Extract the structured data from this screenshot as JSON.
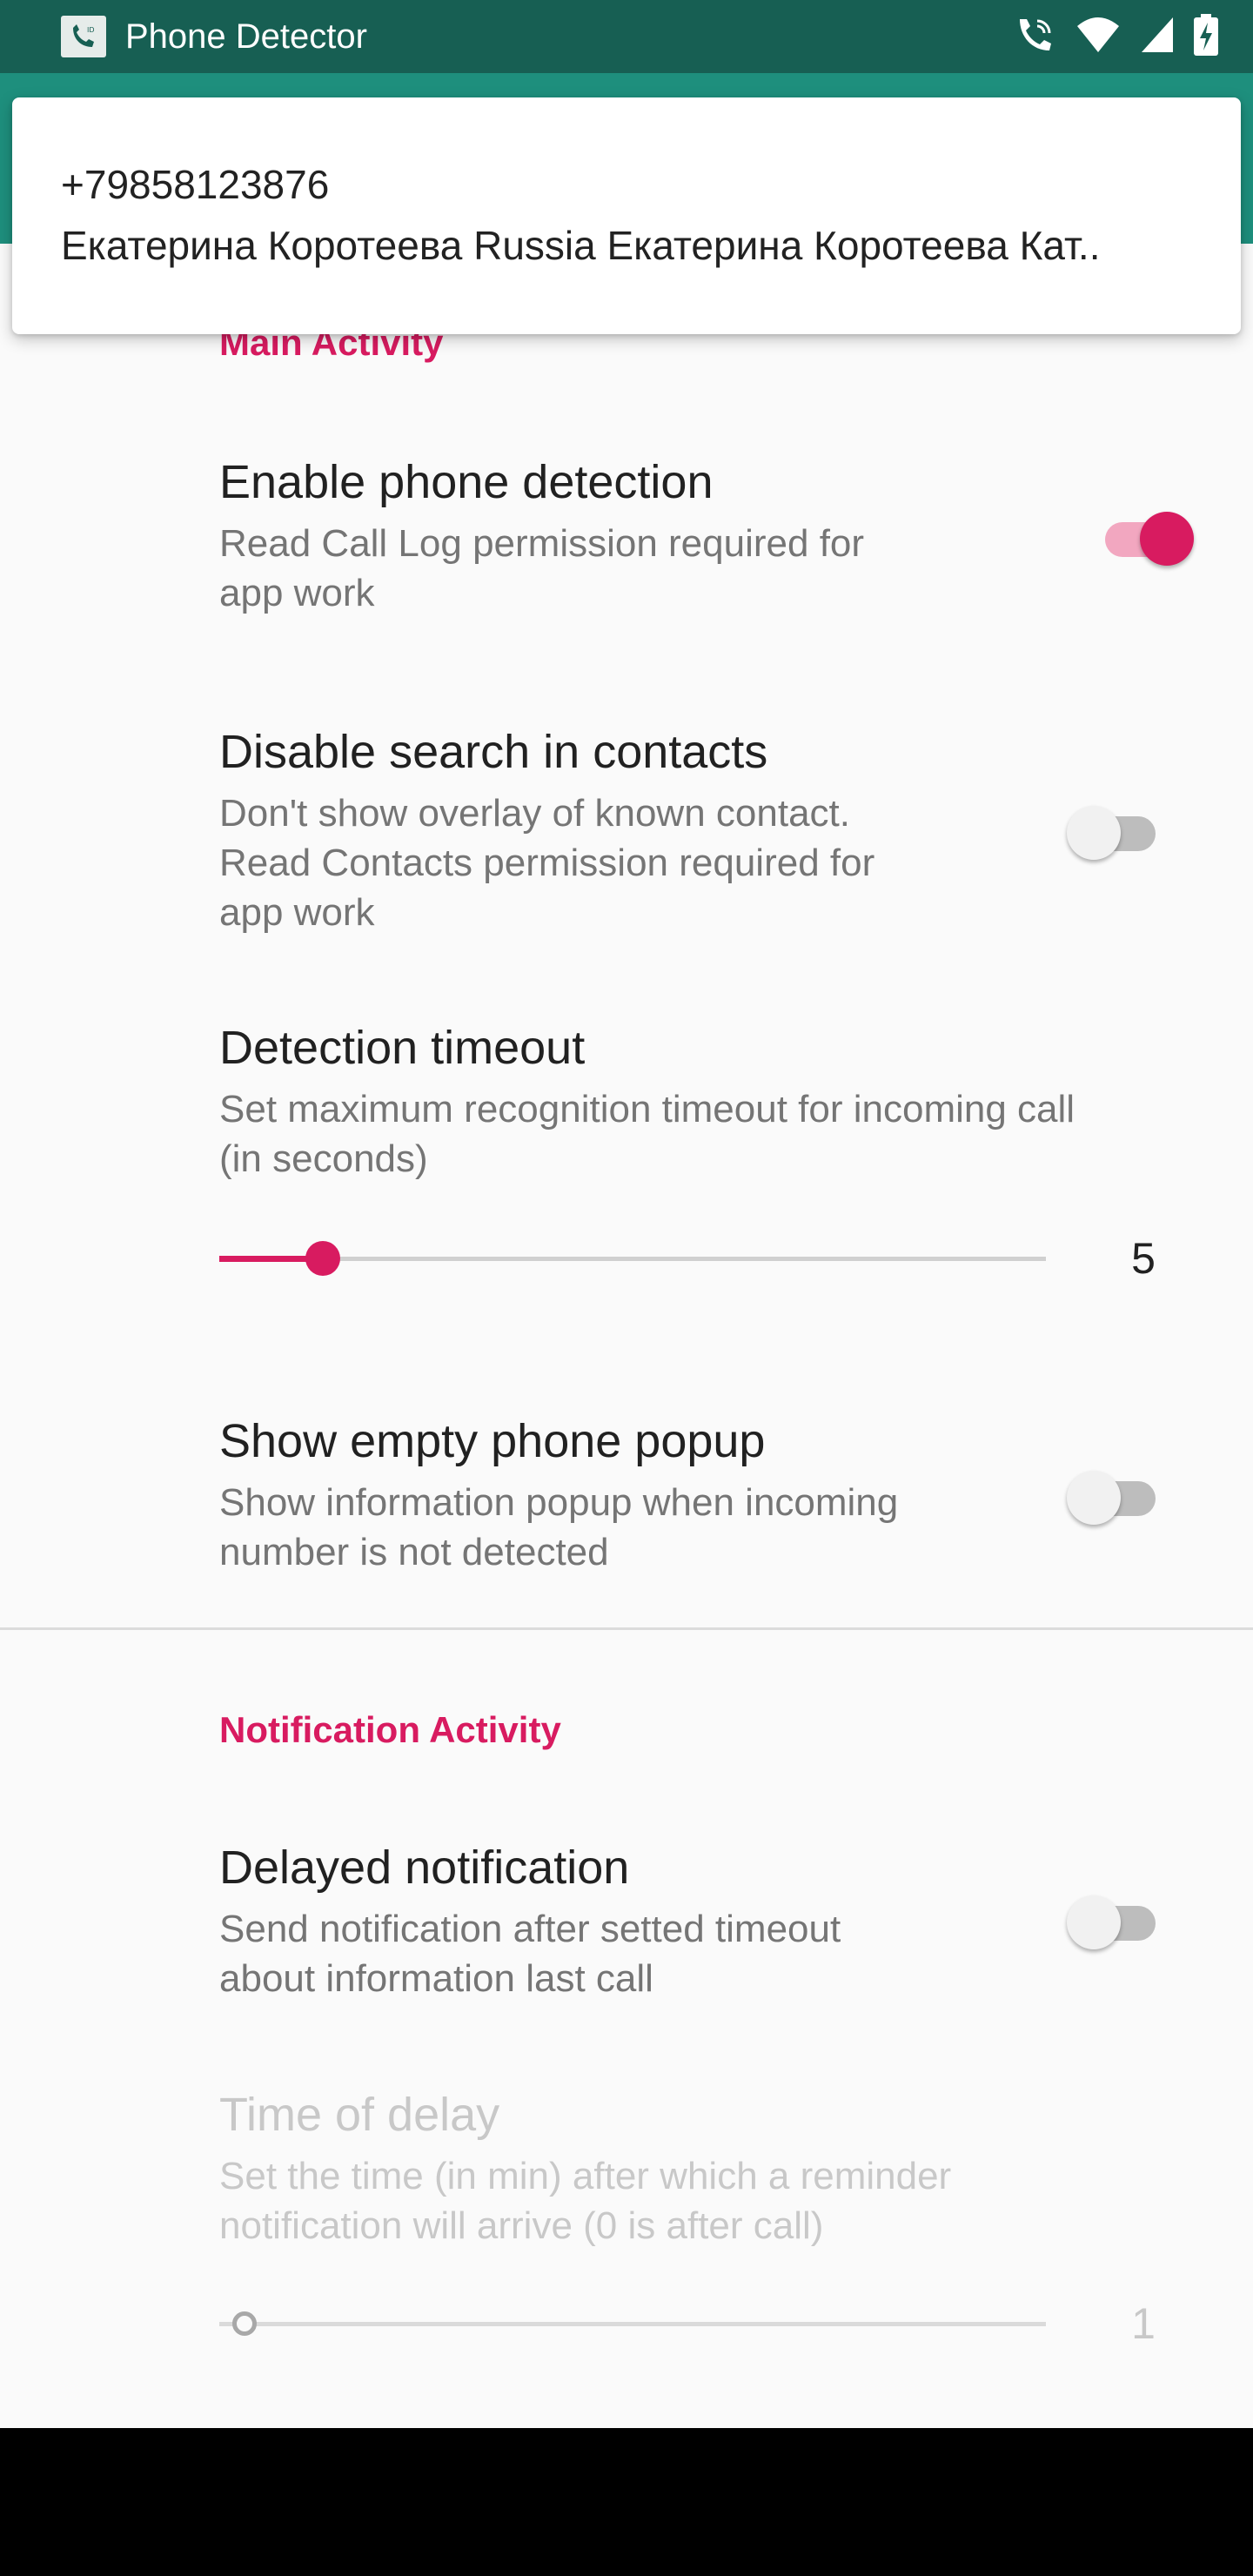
{
  "statusbar": {
    "title": "Phone Detector",
    "icons": [
      "wifi-call-icon",
      "wifi-icon",
      "signal-icon",
      "battery-charging-icon"
    ]
  },
  "popup": {
    "phone": "+79858123876",
    "text": "Екатерина Коротеева Russia Екатерина Коротеева Кат.."
  },
  "sections": {
    "main": "Main Activity",
    "notification": "Notification Activity"
  },
  "prefs": {
    "enable_detection": {
      "title": "Enable phone detection",
      "summary_l1": "Read Call Log permission required for",
      "summary_l2": "app work",
      "checked": true
    },
    "disable_contacts": {
      "title": "Disable search in contacts",
      "summary_l1": "Don't show overlay of known contact.",
      "summary_l2": "Read Contacts permission required for",
      "summary_l3": "app work",
      "checked": false
    },
    "detection_timeout": {
      "title": "Detection timeout",
      "summary_l1": "Set maximum recognition timeout for incoming call",
      "summary_l2": "(in seconds)",
      "value": "5",
      "fraction": 0.125
    },
    "empty_popup": {
      "title": "Show empty phone popup",
      "summary_l1": "Show information popup when incoming",
      "summary_l2": "number is not detected",
      "checked": false
    },
    "delayed_notification": {
      "title": "Delayed notification",
      "summary_l1": "Send notification after setted timeout",
      "summary_l2": "about information last call",
      "checked": false
    },
    "time_of_delay": {
      "title": "Time of delay",
      "summary_l1": "Set the time (in min) after which a reminder",
      "summary_l2": "notification will arrive (0 is after call)",
      "value": "1",
      "fraction": 0.03,
      "enabled": false
    }
  },
  "colors": {
    "accent": "#d81b60",
    "statusbar": "#175f53",
    "toolbar": "#1e8f7d"
  }
}
